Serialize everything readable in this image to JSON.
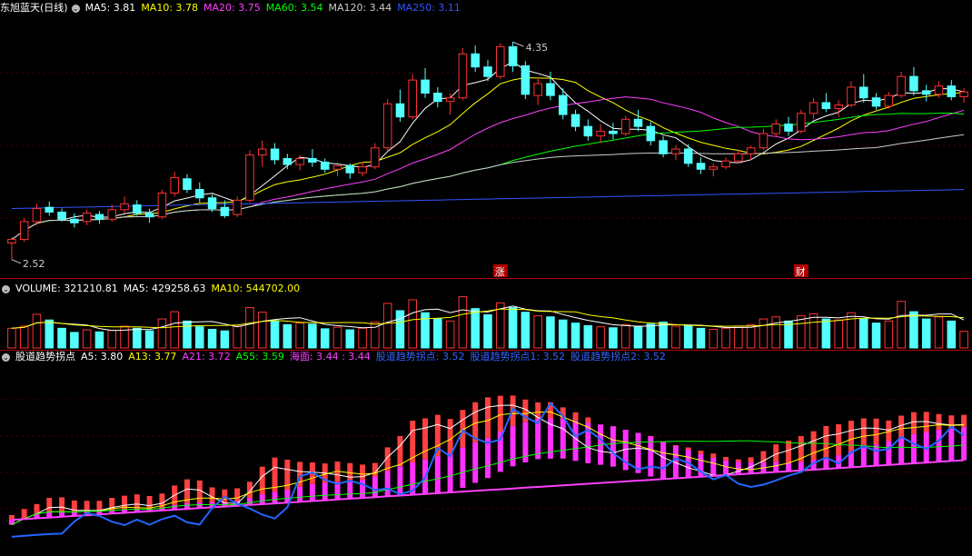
{
  "header_main": {
    "title": "东旭蓝天(日线)",
    "items": [
      {
        "label": "MA5: 3.81",
        "color": "#ffffff"
      },
      {
        "label": "MA10: 3.78",
        "color": "#ffff00"
      },
      {
        "label": "MA20: 3.75",
        "color": "#ff40ff"
      },
      {
        "label": "MA60: 3.54",
        "color": "#00ff00"
      },
      {
        "label": "MA120: 3.44",
        "color": "#cccccc"
      },
      {
        "label": "MA250: 3.11",
        "color": "#3355ff"
      }
    ]
  },
  "header_volume": {
    "items": [
      {
        "label": "VOLUME: 321210.81",
        "color": "#ffffff"
      },
      {
        "label": "MA5: 429258.63",
        "color": "#ffffff"
      },
      {
        "label": "MA10: 544702.00",
        "color": "#ffff00"
      }
    ]
  },
  "header_indicator": {
    "items": [
      {
        "label": "股道趋势拐点",
        "color": "#ffffff"
      },
      {
        "label": "A5: 3.80",
        "color": "#ffffff"
      },
      {
        "label": "A13: 3.77",
        "color": "#ffff00"
      },
      {
        "label": "A21: 3.72",
        "color": "#ff40ff"
      },
      {
        "label": "A55: 3.59",
        "color": "#00ff00"
      },
      {
        "label": "海面: 3.44 : 3.44",
        "color": "#ff40ff"
      },
      {
        "label": "股道趋势拐点: 3.52",
        "color": "#3366ff"
      },
      {
        "label": "股道趋势拐点1: 3.52",
        "color": "#3366ff"
      },
      {
        "label": "股道趋势拐点2: 3.52",
        "color": "#3366ff"
      }
    ]
  },
  "markers": {
    "high_label": "4.35",
    "low_label": "2.52",
    "event1": "涨",
    "event2": "财"
  },
  "chart_data": {
    "type": "candlestick",
    "title": "东旭蓝天(日线)",
    "price_range": [
      2.45,
      4.55
    ],
    "volume_range": [
      0,
      1000000
    ],
    "candles": [
      [
        2.66,
        2.71,
        2.52,
        2.69
      ],
      [
        2.69,
        2.87,
        2.67,
        2.84
      ],
      [
        2.84,
        2.99,
        2.81,
        2.95
      ],
      [
        2.96,
        3.01,
        2.89,
        2.92
      ],
      [
        2.92,
        2.95,
        2.84,
        2.86
      ],
      [
        2.86,
        2.91,
        2.79,
        2.83
      ],
      [
        2.84,
        2.94,
        2.81,
        2.91
      ],
      [
        2.9,
        2.93,
        2.82,
        2.86
      ],
      [
        2.86,
        2.98,
        2.84,
        2.94
      ],
      [
        2.94,
        3.05,
        2.91,
        2.99
      ],
      [
        2.98,
        3.02,
        2.89,
        2.91
      ],
      [
        2.91,
        2.95,
        2.83,
        2.88
      ],
      [
        2.88,
        3.11,
        2.86,
        3.08
      ],
      [
        3.08,
        3.26,
        3.05,
        3.21
      ],
      [
        3.2,
        3.24,
        3.08,
        3.11
      ],
      [
        3.11,
        3.17,
        3.0,
        3.04
      ],
      [
        3.04,
        3.07,
        2.92,
        2.95
      ],
      [
        2.96,
        3.02,
        2.87,
        2.89
      ],
      [
        2.9,
        3.05,
        2.88,
        3.02
      ],
      [
        3.02,
        3.44,
        3.0,
        3.4
      ],
      [
        3.4,
        3.52,
        3.3,
        3.45
      ],
      [
        3.45,
        3.5,
        3.32,
        3.36
      ],
      [
        3.37,
        3.41,
        3.28,
        3.32
      ],
      [
        3.32,
        3.4,
        3.27,
        3.37
      ],
      [
        3.37,
        3.45,
        3.3,
        3.34
      ],
      [
        3.34,
        3.37,
        3.25,
        3.28
      ],
      [
        3.28,
        3.34,
        3.22,
        3.31
      ],
      [
        3.31,
        3.33,
        3.2,
        3.25
      ],
      [
        3.25,
        3.34,
        3.22,
        3.3
      ],
      [
        3.3,
        3.5,
        3.28,
        3.46
      ],
      [
        3.46,
        3.87,
        3.43,
        3.83
      ],
      [
        3.83,
        3.95,
        3.68,
        3.72
      ],
      [
        3.72,
        4.08,
        3.7,
        4.03
      ],
      [
        4.03,
        4.13,
        3.88,
        3.92
      ],
      [
        3.92,
        3.97,
        3.8,
        3.85
      ],
      [
        3.85,
        3.92,
        3.74,
        3.88
      ],
      [
        3.88,
        4.3,
        3.86,
        4.25
      ],
      [
        4.25,
        4.32,
        4.1,
        4.14
      ],
      [
        4.14,
        4.2,
        4.02,
        4.06
      ],
      [
        4.06,
        4.34,
        4.04,
        4.31
      ],
      [
        4.31,
        4.35,
        4.1,
        4.15
      ],
      [
        4.15,
        4.19,
        3.87,
        3.91
      ],
      [
        3.9,
        4.05,
        3.82,
        4.0
      ],
      [
        4.0,
        4.1,
        3.86,
        3.9
      ],
      [
        3.9,
        3.96,
        3.7,
        3.74
      ],
      [
        3.74,
        3.78,
        3.6,
        3.64
      ],
      [
        3.64,
        3.7,
        3.52,
        3.56
      ],
      [
        3.56,
        3.66,
        3.5,
        3.6
      ],
      [
        3.6,
        3.67,
        3.53,
        3.58
      ],
      [
        3.58,
        3.73,
        3.56,
        3.7
      ],
      [
        3.7,
        3.78,
        3.6,
        3.64
      ],
      [
        3.64,
        3.68,
        3.48,
        3.52
      ],
      [
        3.52,
        3.56,
        3.38,
        3.41
      ],
      [
        3.41,
        3.48,
        3.36,
        3.45
      ],
      [
        3.45,
        3.49,
        3.3,
        3.33
      ],
      [
        3.33,
        3.38,
        3.24,
        3.28
      ],
      [
        3.28,
        3.33,
        3.22,
        3.3
      ],
      [
        3.3,
        3.38,
        3.28,
        3.35
      ],
      [
        3.35,
        3.44,
        3.33,
        3.41
      ],
      [
        3.41,
        3.48,
        3.36,
        3.46
      ],
      [
        3.46,
        3.62,
        3.44,
        3.58
      ],
      [
        3.58,
        3.7,
        3.55,
        3.66
      ],
      [
        3.66,
        3.72,
        3.56,
        3.6
      ],
      [
        3.6,
        3.78,
        3.58,
        3.75
      ],
      [
        3.75,
        3.88,
        3.7,
        3.84
      ],
      [
        3.84,
        3.92,
        3.76,
        3.79
      ],
      [
        3.79,
        3.86,
        3.72,
        3.82
      ],
      [
        3.82,
        4.02,
        3.8,
        3.97
      ],
      [
        3.97,
        4.08,
        3.84,
        3.88
      ],
      [
        3.88,
        3.92,
        3.78,
        3.81
      ],
      [
        3.81,
        3.93,
        3.79,
        3.9
      ],
      [
        3.9,
        4.1,
        3.88,
        4.06
      ],
      [
        4.06,
        4.14,
        3.9,
        3.94
      ],
      [
        3.94,
        3.99,
        3.85,
        3.91
      ],
      [
        3.91,
        4.02,
        3.88,
        3.98
      ],
      [
        3.98,
        4.03,
        3.86,
        3.89
      ],
      [
        3.89,
        3.96,
        3.84,
        3.93
      ]
    ],
    "volume": [
      380000,
      420000,
      650000,
      540000,
      380000,
      300000,
      350000,
      310000,
      340000,
      420000,
      380000,
      330000,
      560000,
      700000,
      520000,
      410000,
      360000,
      330000,
      420000,
      780000,
      690000,
      520000,
      450000,
      480000,
      460000,
      370000,
      400000,
      350000,
      380000,
      500000,
      860000,
      720000,
      930000,
      680000,
      560000,
      520000,
      990000,
      760000,
      640000,
      870000,
      780000,
      690000,
      620000,
      600000,
      540000,
      480000,
      430000,
      410000,
      390000,
      450000,
      420000,
      460000,
      500000,
      420000,
      430000,
      380000,
      360000,
      380000,
      420000,
      450000,
      560000,
      600000,
      520000,
      620000,
      660000,
      560000,
      540000,
      680000,
      560000,
      480000,
      520000,
      900000,
      700000,
      560000,
      600000,
      520000,
      321210
    ],
    "indicator_values": {
      "A5": 3.8,
      "A13": 3.77,
      "A21": 3.72,
      "A55": 3.59,
      "海面": 3.44,
      "股道趋势拐点": 3.52
    },
    "colors": {
      "up": "#ff3232",
      "down": "#54ffff",
      "ma5": "#ffffff",
      "ma10": "#ffff00",
      "ma20": "#ff40ff",
      "ma60": "#00ff00",
      "ma120": "#cccccc",
      "ma250": "#3355ff",
      "trend": "#2266ff",
      "sea": "#ff40ff"
    }
  }
}
